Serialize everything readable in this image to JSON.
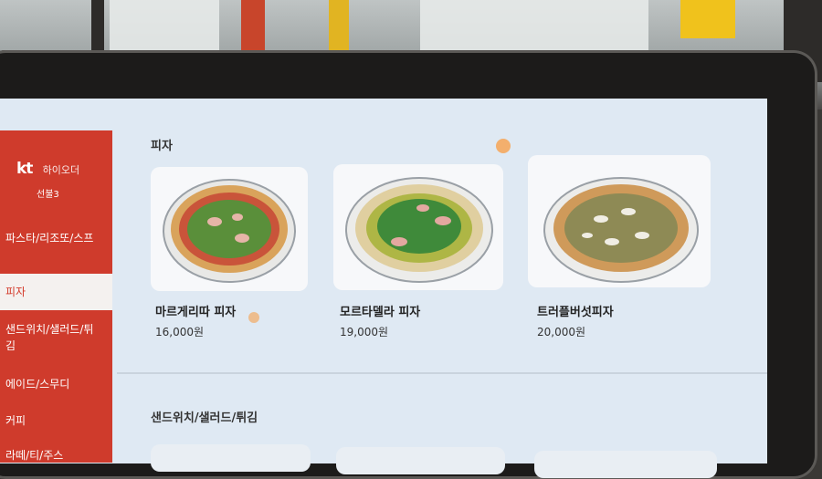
{
  "sidebar": {
    "brand": "kt",
    "brand_sub": "하이오더",
    "table_label": "선불3",
    "items": [
      {
        "label": "파스타/리조또/스프",
        "active": false
      },
      {
        "label": "피자",
        "active": true
      },
      {
        "label": "샌드위치/샐러드/튀김",
        "active": false
      },
      {
        "label": "에이드/스무디",
        "active": false
      },
      {
        "label": "커피",
        "active": false
      },
      {
        "label": "라떼/티/주스",
        "active": false
      }
    ]
  },
  "sections": [
    {
      "title": "피자",
      "items": [
        {
          "name": "마르게리따 피자",
          "price": "16,000원"
        },
        {
          "name": "모르타델라 피자",
          "price": "19,000원"
        },
        {
          "name": "트러플버섯피자",
          "price": "20,000원"
        }
      ]
    },
    {
      "title": "샌드위치/샐러드/튀김",
      "items": []
    }
  ],
  "colors": {
    "sidebar_bg": "#cf3b2c",
    "active_tab_text": "#d33a2a",
    "screen_bg": "#dfe9f3"
  }
}
